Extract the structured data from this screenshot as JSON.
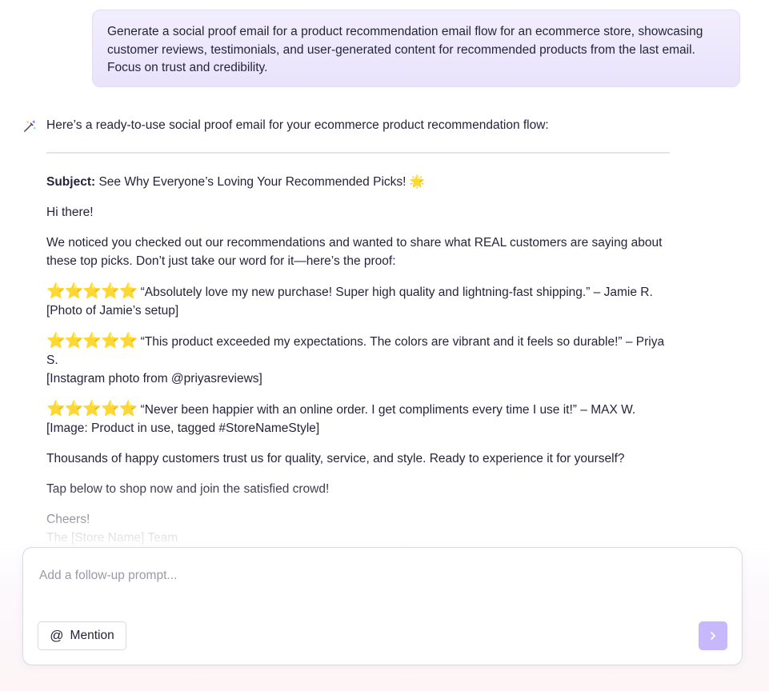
{
  "user_message": {
    "text": "Generate a social proof email for a product recommendation email flow for an ecommerce store, showcasing customer reviews, testimonials, and user-generated content for recommended products from the last email. Focus on trust and credibility."
  },
  "assistant": {
    "icon": "magic-wand-icon",
    "intro": "Here’s a ready-to-use social proof email for your ecommerce product recommendation flow:",
    "email": {
      "subject_label": "Subject:",
      "subject_text": "See Why Everyone’s Loving Your Recommended Picks! 🌟",
      "greeting": "Hi there!",
      "intro_paragraph": "We noticed you checked out our recommendations and wanted to share what REAL customers are saying about these top picks. Don’t just take our word for it—here’s the proof:",
      "reviews": [
        {
          "stars": "⭐⭐⭐⭐⭐",
          "quote": "“Absolutely love my new purchase! Super high quality and lightning-fast shipping.” – Jamie R.",
          "media": "[Photo of Jamie’s setup]"
        },
        {
          "stars": "⭐⭐⭐⭐⭐",
          "quote": "“This product exceeded my expectations. The colors are vibrant and it feels so durable!” – Priya S.",
          "media": "[Instagram photo from @priyasreviews]"
        },
        {
          "stars": "⭐⭐⭐⭐⭐",
          "quote": "“Never been happier with an online order. I get compliments every time I use it!” – MAX W.",
          "media": "[Image: Product in use, tagged #StoreNameStyle]"
        }
      ],
      "trust_paragraph": "Thousands of happy customers trust us for quality, service, and style. Ready to experience it for yourself?",
      "cta_paragraph": "Tap below to shop now and join the satisfied crowd!",
      "signoff": "Cheers!",
      "team": "The [Store Name] Team"
    }
  },
  "composer": {
    "placeholder": "Add a follow-up prompt...",
    "mention_label": "Mention",
    "mention_icon": "at-icon",
    "send_icon": "chevron-right-icon"
  },
  "colors": {
    "user_bubble": "#ede8fc",
    "send_button": "#c7b8fb",
    "text": "#26243a",
    "muted": "#8b8b96"
  }
}
